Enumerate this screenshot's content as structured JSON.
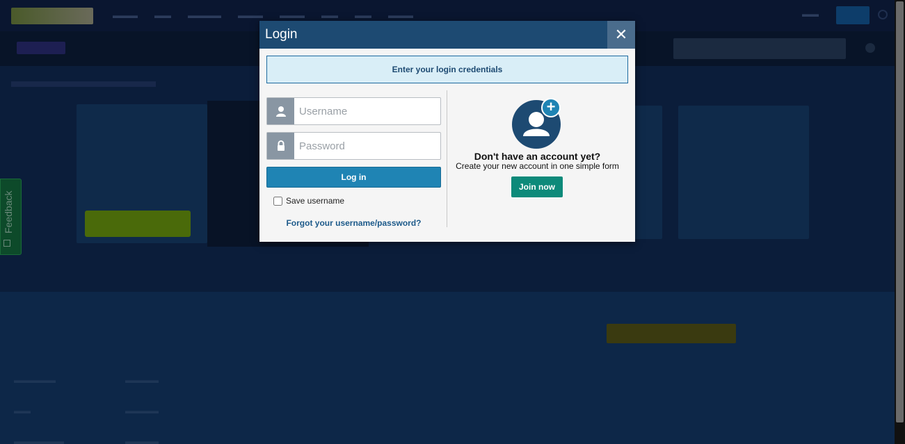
{
  "modal": {
    "title": "Login",
    "close_symbol": "✕",
    "notice": "Enter your login credentials",
    "username_placeholder": "Username",
    "password_placeholder": "Password",
    "login_button": "Log in",
    "save_username_label": "Save username",
    "save_username_checked": false,
    "forgot_link": "Forgot your username/password?",
    "no_account_heading": "Don't have an account yet?",
    "create_account_text": "Create your new account in one simple form",
    "join_button": "Join now",
    "plus_symbol": "+"
  },
  "feedback": {
    "label": "Feedback"
  },
  "colors": {
    "header": "#1d4a72",
    "login_button": "#1f84b4",
    "join_button": "#0d8a7a",
    "notice_bg": "#d9eef7"
  },
  "icons": {
    "username": "user-icon",
    "password": "lock-icon",
    "avatar": "user-add-icon",
    "close": "close-icon"
  }
}
